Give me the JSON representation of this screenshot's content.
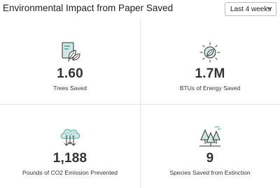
{
  "header": {
    "title": "Environmental Impact from Paper Saved",
    "period_select": {
      "value": "Last 4 weeks"
    }
  },
  "colors": {
    "accent_teal": "#4aa9a0",
    "outline": "#333333",
    "divider": "#e6e6e6"
  },
  "metrics": [
    {
      "icon": "paper-leaf-icon",
      "value": "1.60",
      "label": "Trees Saved"
    },
    {
      "icon": "sun-leaf-icon",
      "value": "1.7M",
      "label": "BTUs of Energy Saved"
    },
    {
      "icon": "cloud-arrows-icon",
      "value": "1,188",
      "label": "Pounds of CO2 Emission Prevented"
    },
    {
      "icon": "trees-birds-icon",
      "value": "9",
      "label": "Species Saved from Extinction"
    }
  ]
}
